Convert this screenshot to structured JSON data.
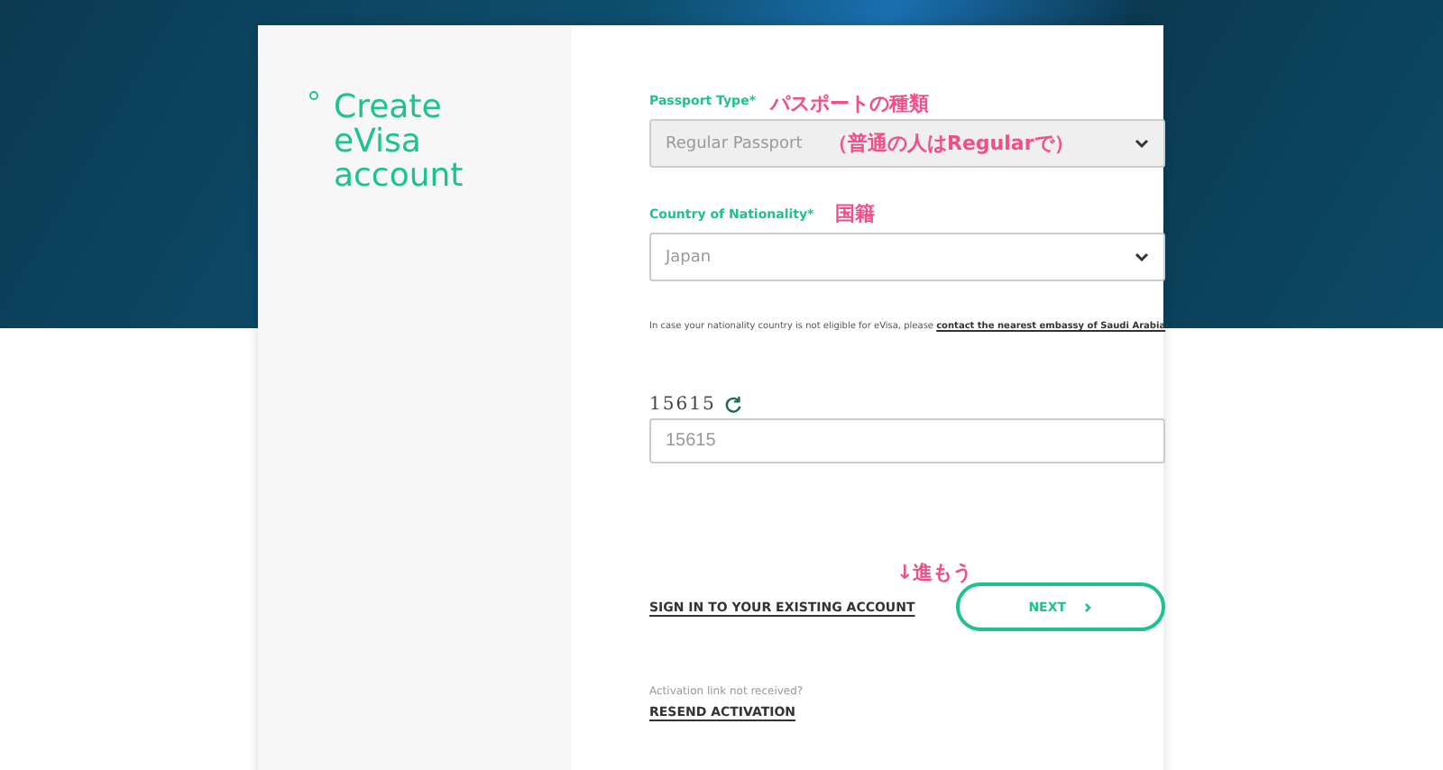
{
  "title": "Create eVisa account",
  "fields": [
    {
      "label": "Passport Type*",
      "value": "Regular Passport",
      "disabled": true
    },
    {
      "label": "Country of Nationality*",
      "value": "Japan",
      "disabled": false
    }
  ],
  "note": {
    "text": "In case your nationality country is not eligible for eVisa, please ",
    "link": "contact the nearest embassy of Saudi Arabia"
  },
  "captcha": {
    "code": "15615",
    "value": "15615"
  },
  "sign_in_link": "SIGN IN TO YOUR EXISTING ACCOUNT",
  "next_button": "NEXT",
  "activation": {
    "text": "Activation link not received?",
    "link": "RESEND ACTIVATION"
  },
  "annotations": [
    {
      "text": "パスポートの種類"
    },
    {
      "text": "（普通の人はRegularで）"
    },
    {
      "text": "国籍"
    },
    {
      "text": "↓進もう"
    }
  ]
}
